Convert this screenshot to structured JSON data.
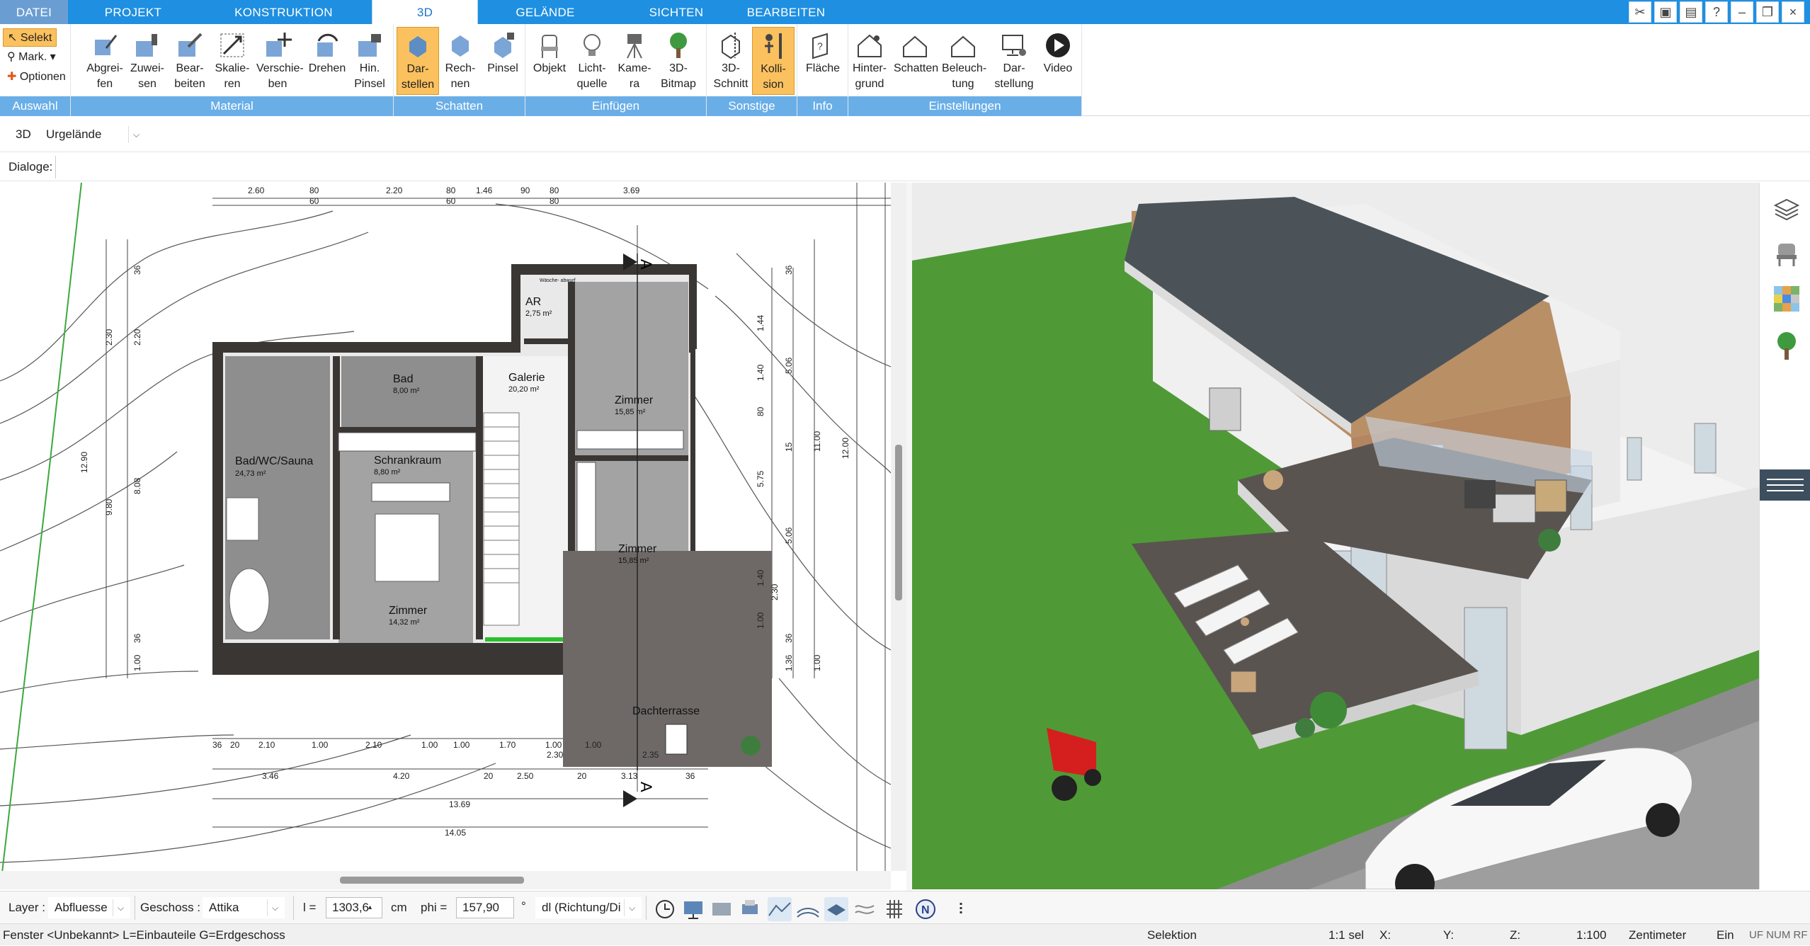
{
  "tabs": [
    {
      "label": "DATEI"
    },
    {
      "label": "PROJEKT"
    },
    {
      "label": "KONSTRUKTION"
    },
    {
      "label": "3D"
    },
    {
      "label": "GELÄNDE"
    },
    {
      "label": "SICHTEN"
    },
    {
      "label": "BEARBEITEN"
    }
  ],
  "ribbon": {
    "auswahl": {
      "select": "Selekt",
      "mark": "Mark.",
      "options": "Optionen",
      "label": "Auswahl"
    },
    "material": {
      "label": "Material",
      "buttons": [
        "Abgrei-\nfen",
        "Zuwei-\nsen",
        "Bear-\nbeiten",
        "Skalie-\nren",
        "Verschie-\nben",
        "Drehen",
        "Hin.\nPinsel"
      ]
    },
    "schatten": {
      "label": "Schatten",
      "buttons": [
        "Dar-\nstellen",
        "Rech-\nnen",
        "Pinsel"
      ]
    },
    "einfuegen": {
      "label": "Einfügen",
      "buttons": [
        "Objekt",
        "Licht-\nquelle",
        "Kame-\nra",
        "3D-\nBitmap"
      ]
    },
    "sonstige": {
      "label": "Sonstige",
      "buttons": [
        "3D-\nSchnitt",
        "Kolli-\nsion"
      ]
    },
    "info": {
      "label": "Info",
      "buttons": [
        "Fläche"
      ]
    },
    "einstellungen": {
      "label": "Einstellungen",
      "buttons": [
        "Hinter-\ngrund",
        "Schatten",
        "Beleuch-\ntung",
        "Dar-\nstellung",
        "Video"
      ]
    }
  },
  "row2": {
    "mode": "3D",
    "terrain": "Urgelände"
  },
  "row3": {
    "dialoge": "Dialoge:"
  },
  "plan": {
    "rooms": [
      {
        "name": "Bad/WC/Sauna",
        "area": "24,73 m²"
      },
      {
        "name": "Bad",
        "area": "8,00 m²"
      },
      {
        "name": "Galerie",
        "area": "20,20 m²"
      },
      {
        "name": "AR",
        "area": "2,75 m²"
      },
      {
        "name": "Zimmer",
        "area": "15,85 m²"
      },
      {
        "name": "Schrankraum",
        "area": "8,80 m²"
      },
      {
        "name": "Zimmer",
        "area": "15,85 m²"
      },
      {
        "name": "Zimmer",
        "area": "14,32 m²"
      },
      {
        "name": "Dachterrasse",
        "area": ""
      }
    ],
    "top_dims": [
      "2.60",
      "80",
      "2.20",
      "80",
      "1.46",
      "90",
      "80",
      "3.69"
    ],
    "top_dims2": [
      "60",
      "60",
      "80"
    ],
    "bottom_dims": [
      "36",
      "20",
      "2.10",
      "1.00",
      "2.10",
      "1.00",
      "1.00",
      "1.70",
      "1.00",
      "1.00"
    ],
    "bottom_dims2": [
      "3.46",
      "4.20",
      "20",
      "2.50",
      "20",
      "3.13",
      "36"
    ],
    "bottom_total1": "13.69",
    "bottom_total2": "14.05",
    "extra_dims": [
      "2.30",
      "2.35"
    ],
    "left_dims": [
      "2.30",
      "2.20",
      "36",
      "12.90",
      "9.80",
      "8.08",
      "36",
      "1.00"
    ],
    "right_dims": [
      "36",
      "1.44",
      "1.40",
      "80",
      "5.06",
      "15",
      "5.75",
      "5.06",
      "1.40",
      "1.00",
      "2.30",
      "36",
      "1.36",
      "11.00",
      "12.00",
      "1.00"
    ],
    "section_mark": "A",
    "wc_note": "Wäsche-\nabwurf"
  },
  "bottom": {
    "layer_label": "Layer :",
    "layer_value": "Abfluesse",
    "geschoss_label": "Geschoss :",
    "geschoss_value": "Attika",
    "l_label": "l =",
    "l_value": "1303,6",
    "l_unit": "cm",
    "phi_label": "phi =",
    "phi_value": "157,90",
    "phi_unit": "°",
    "dl_value": "dl (Richtung/Di"
  },
  "status": {
    "left": "Fenster <Unbekannt> L=Einbauteile G=Erdgeschoss",
    "mode": "Selektion",
    "sel": "1:1 sel",
    "x": "X:",
    "y": "Y:",
    "z": "Z:",
    "scale": "1:100",
    "unit": "Zentimeter",
    "ein": "Ein",
    "flags": "UF NUM RF"
  },
  "colors": {
    "tabbar": "#1e8fe1",
    "group_label": "#6aaee7",
    "selected": "#fbc15e",
    "grass": "#4f9a36",
    "deck": "#5a5450",
    "roof": "#4b5358",
    "wood": "#b98f66"
  }
}
